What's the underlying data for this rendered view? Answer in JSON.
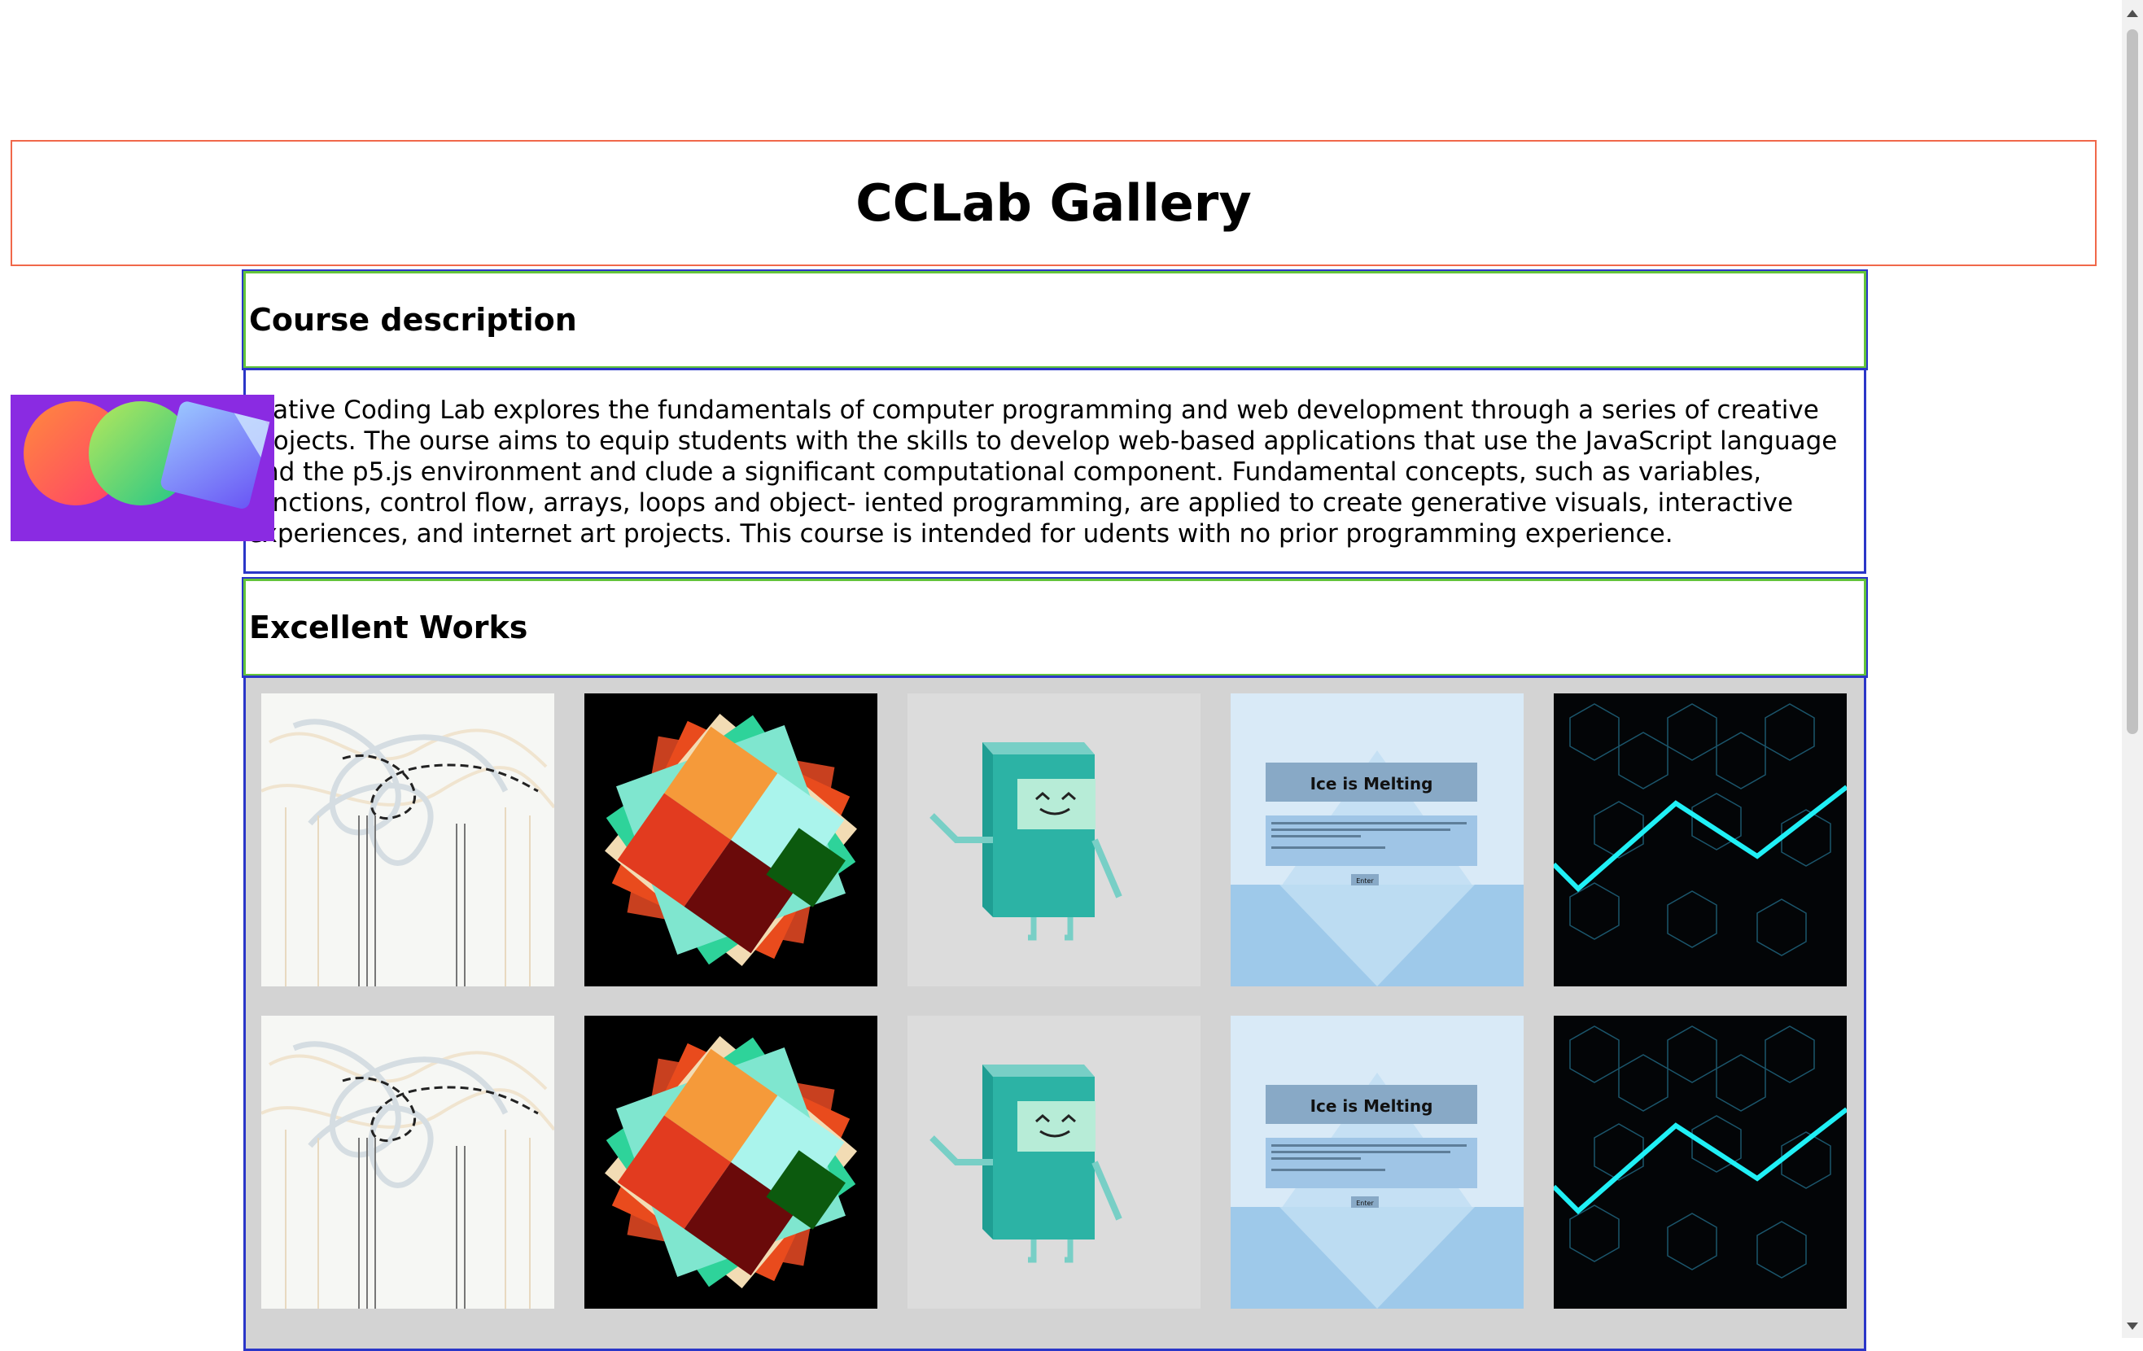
{
  "page": {
    "title": "CCLab Gallery"
  },
  "sections": [
    {
      "heading": "Course description"
    },
    {
      "heading": "Excellent Works"
    }
  ],
  "description": {
    "text": "reative Coding Lab explores the fundamentals of computer programming and web development through a series of creative projects. The ourse aims to equip students with the skills to develop web-based applications that use the JavaScript language and the p5.js environment and clude a significant computational component. Fundamental concepts, such as variables, functions, control flow, arrays, loops and object- iented programming, are applied to create generative visuals, interactive experiences, and internet art projects. This course is intended for udents with no prior programming experience."
  },
  "gallery": {
    "works": [
      {
        "thumbnail": "abstract-lines-artwork"
      },
      {
        "thumbnail": "rotating-squares-artwork"
      },
      {
        "thumbnail": "robot-character-artwork"
      },
      {
        "thumbnail": "ice-is-melting-artwork",
        "text": "Ice is Melting",
        "button": "Enter"
      },
      {
        "thumbnail": "hexagon-network-artwork"
      }
    ]
  },
  "colors": {
    "header_border": "#f0684a",
    "section_border": "#63c43a",
    "box_border": "#2a36c8",
    "gallery_bg": "#d3d3d3",
    "logo_bg": "#8a2be2"
  }
}
